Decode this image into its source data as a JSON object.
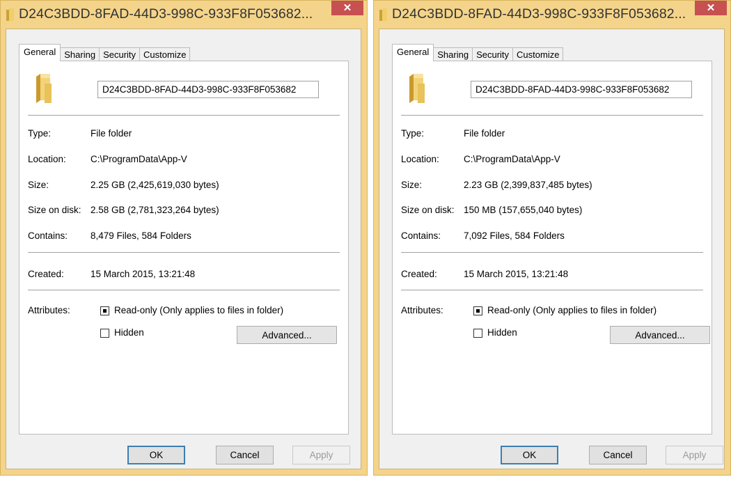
{
  "colors": {
    "titlebar": "#f4d48a",
    "close": "#c75050",
    "dialog": "#f0f0f0",
    "default_button_border": "#3c7fb1"
  },
  "dialogs": [
    {
      "title": "D24C3BDD-8FAD-44D3-998C-933F8F053682...",
      "close_glyph": "✕",
      "tabs": [
        "General",
        "Sharing",
        "Security",
        "Customize"
      ],
      "active_tab": "General",
      "folder_name": "D24C3BDD-8FAD-44D3-998C-933F8F053682",
      "props": {
        "type_label": "Type:",
        "type_value": "File folder",
        "location_label": "Location:",
        "location_value": "C:\\ProgramData\\App-V",
        "size_label": "Size:",
        "size_value": "2.25 GB (2,425,619,030 bytes)",
        "disk_label": "Size on disk:",
        "disk_value": "2.58 GB (2,781,323,264 bytes)",
        "contains_label": "Contains:",
        "contains_value": "8,479 Files, 584 Folders",
        "created_label": "Created:",
        "created_value": "15 March 2015, 13:21:48",
        "attributes_label": "Attributes:"
      },
      "readonly_label": "Read-only (Only applies to files in folder)",
      "readonly_state": "indeterminate",
      "hidden_label": "Hidden",
      "hidden_checked": false,
      "advanced_label": "Advanced...",
      "ok_label": "OK",
      "cancel_label": "Cancel",
      "apply_label": "Apply"
    },
    {
      "title": "D24C3BDD-8FAD-44D3-998C-933F8F053682...",
      "close_glyph": "✕",
      "tabs": [
        "General",
        "Sharing",
        "Security",
        "Customize"
      ],
      "active_tab": "General",
      "folder_name": "D24C3BDD-8FAD-44D3-998C-933F8F053682",
      "props": {
        "type_label": "Type:",
        "type_value": "File folder",
        "location_label": "Location:",
        "location_value": "C:\\ProgramData\\App-V",
        "size_label": "Size:",
        "size_value": "2.23 GB (2,399,837,485 bytes)",
        "disk_label": "Size on disk:",
        "disk_value": "150 MB (157,655,040 bytes)",
        "contains_label": "Contains:",
        "contains_value": "7,092 Files, 584 Folders",
        "created_label": "Created:",
        "created_value": "15 March 2015, 13:21:48",
        "attributes_label": "Attributes:"
      },
      "readonly_label": "Read-only (Only applies to files in folder)",
      "readonly_state": "indeterminate",
      "hidden_label": "Hidden",
      "hidden_checked": false,
      "advanced_label": "Advanced...",
      "ok_label": "OK",
      "cancel_label": "Cancel",
      "apply_label": "Apply"
    }
  ]
}
